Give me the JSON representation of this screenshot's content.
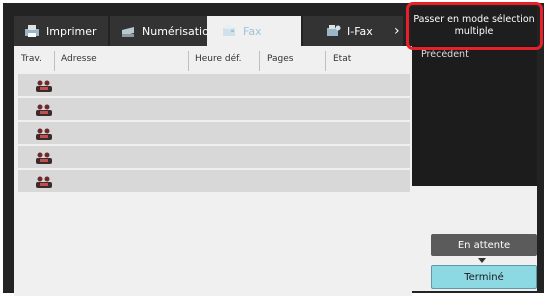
{
  "tabs": [
    {
      "label": "Imprimer",
      "icon": "printer-icon"
    },
    {
      "label": "Numérisation",
      "icon": "scanner-icon"
    },
    {
      "label": "Fax",
      "icon": "fax-icon"
    },
    {
      "label": "I-Fax",
      "icon": "ifax-icon"
    }
  ],
  "active_tab": "Fax",
  "nav_arrow": "›",
  "columns": [
    "Trav.",
    "Adresse",
    "Heure déf.",
    "Pages",
    "Etat"
  ],
  "rows": [
    {
      "icon": "job-icon"
    },
    {
      "icon": "job-icon"
    },
    {
      "icon": "job-icon"
    },
    {
      "icon": "job-icon"
    },
    {
      "icon": "job-icon"
    }
  ],
  "side": {
    "multi_select_label": "Passer en mode sélection multiple",
    "previous_label": "Précédent",
    "waiting_label": "En attente",
    "done_label": "Terminé"
  },
  "colors": {
    "highlight": "#e8202a",
    "done_button": "#8cd8e3",
    "active_tab_text": "#9ec3d8"
  }
}
